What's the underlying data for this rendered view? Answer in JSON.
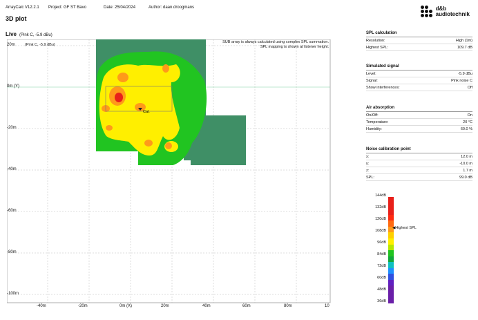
{
  "topbar": {
    "app": "ArrayCalc V12.2.1",
    "project": "Project: GF ST Bavo",
    "date": "Date: 25/04/2024",
    "author": "Author: daan.droogmans",
    "brand_line1": "d&b",
    "brand_line2": "audiotechnik"
  },
  "page_title": "3D plot",
  "live": {
    "label": "Live",
    "signal": "(Pink C, -5.9 dBu)"
  },
  "plot": {
    "inner_tag": "(Pink C, -5.9 dBu)",
    "note_line1": "SUB array is always calculated using complex SPL summation.",
    "note_line2": "SPL mapping is shown at listener height.",
    "cal_label": "Cal.",
    "y_labels": [
      "20m",
      "0m (Y)",
      "-20m",
      "-40m",
      "-60m",
      "-80m",
      "-100m"
    ],
    "x_labels": [
      "-40m",
      "-20m",
      "0m (X)",
      "20m",
      "40m",
      "60m",
      "80m",
      "10"
    ],
    "colors": {
      "dark_green": "#3f8f66",
      "green": "#21c421",
      "yellow": "#ffef00",
      "orange": "#ff9a1a",
      "red": "#e8201a"
    }
  },
  "spl_calculation": {
    "title": "SPL calculation",
    "rows": [
      {
        "k": "Resolution:",
        "v": "High (1m)"
      },
      {
        "k": "Highest SPL:",
        "v": "109.7 dB"
      }
    ]
  },
  "simulated_signal": {
    "title": "Simulated signal",
    "rows": [
      {
        "k": "Level:",
        "v": "-5.9 dBu"
      },
      {
        "k": "Signal:",
        "v": "Pink noise C"
      },
      {
        "k": "Show interferences:",
        "v": "Off"
      }
    ]
  },
  "air_absorption": {
    "title": "Air absorption",
    "rows": [
      {
        "k": "On/Off:",
        "v": "On"
      },
      {
        "k": "Temperature:",
        "v": "20 °C"
      },
      {
        "k": "Humidity:",
        "v": "60.0 %"
      }
    ]
  },
  "noise_calibration": {
    "title": "Noise calibration point",
    "rows": [
      {
        "k": "x:",
        "v": "12.0 m"
      },
      {
        "k": "y:",
        "v": "-10.0 m"
      },
      {
        "k": "z:",
        "v": "1.7 m"
      },
      {
        "k": "SPL:",
        "v": "99.0 dB"
      }
    ]
  },
  "legend": {
    "labels": [
      "144dB",
      "132dB",
      "120dB",
      "108dB",
      "96dB",
      "84dB",
      "72dB",
      "60dB",
      "48dB",
      "36dB"
    ],
    "marker": "Highest SPL",
    "colors": [
      "#e8201a",
      "#e8201a",
      "#e8201a",
      "#ff2a10",
      "#ff6a10",
      "#ff9a1a",
      "#ffd000",
      "#ffef00",
      "#b8e800",
      "#21c421",
      "#12a83a",
      "#10c0c0",
      "#1e90ff",
      "#3050e0",
      "#6020c0",
      "#6a1fa8",
      "#6a1fa8",
      "#6a1fa8"
    ]
  }
}
